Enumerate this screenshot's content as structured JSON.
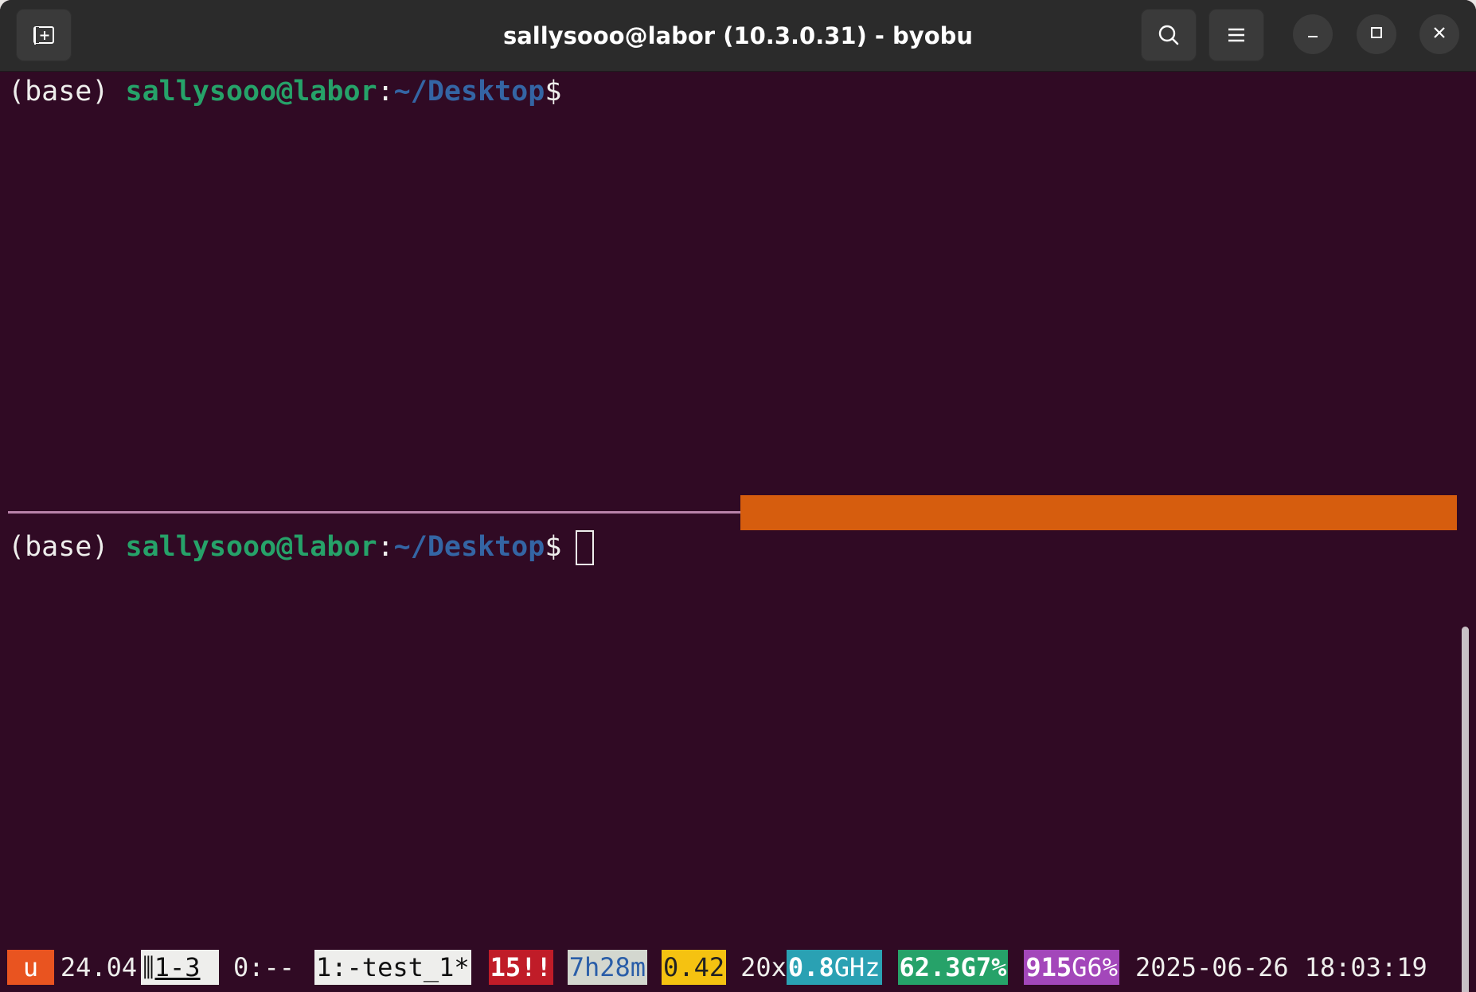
{
  "window": {
    "title": "sallysooo@labor (10.3.0.31) - byobu"
  },
  "icons": {
    "new_tab": "new-tab-icon",
    "search": "search-icon",
    "menu": "hamburger-menu-icon",
    "minimize": "minimize-icon",
    "maximize": "maximize-icon",
    "close": "close-icon"
  },
  "pane_top": {
    "env": "(base)",
    "user_host": "sallysooo@labor",
    "colon": ":",
    "path": "~/Desktop",
    "dollar": "$"
  },
  "pane_bottom": {
    "env": "(base)",
    "user_host": "sallysooo@labor",
    "colon": ":",
    "path": "~/Desktop",
    "dollar": "$"
  },
  "status_bar": {
    "logo": "u",
    "release": "24.04",
    "window_indicator": "⫼1-3",
    "window_0": "0:--",
    "window_1": "1:-test_1*",
    "updates": "15!!",
    "uptime": "7h28m",
    "load": "0.42",
    "cpu_count": "20x",
    "cpu_freq_value": "0.8",
    "cpu_freq_unit": "GHz",
    "memory": "62.3G7%",
    "disk_value": "915",
    "disk_rest": "G6%",
    "date": "2025-06-26",
    "time": "18:03:19"
  },
  "colors": {
    "terminal_bg": "#300a24",
    "titlebar_bg": "#2b2b2b",
    "prompt_user": "#26a269",
    "prompt_path": "#3465a4",
    "active_pane_bar": "#d65d0e"
  }
}
